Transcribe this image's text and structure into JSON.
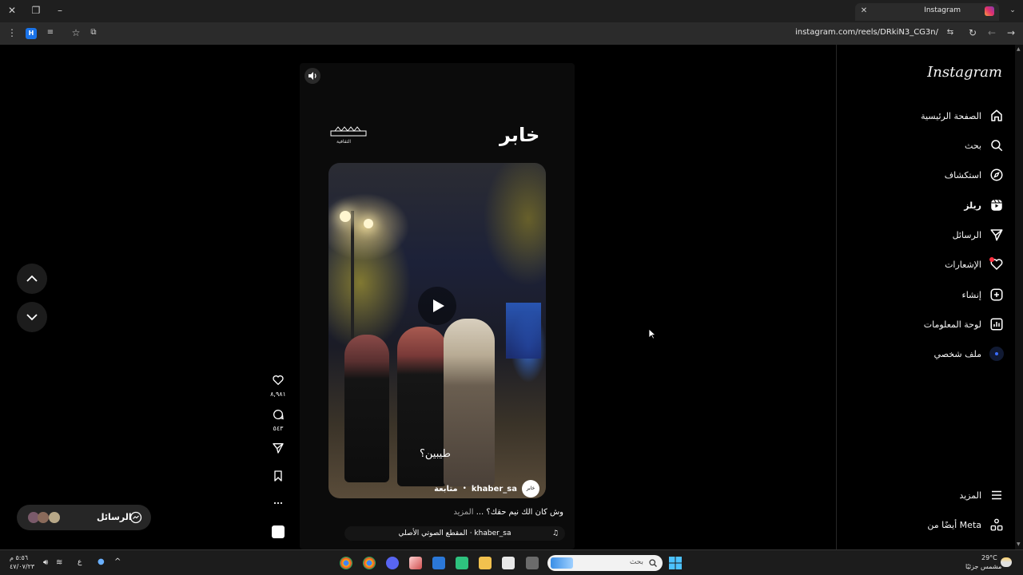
{
  "browser": {
    "tab_title": "Instagram",
    "url": "instagram.com/reels/DRkiN3_CG3n/",
    "profile_letter": "H"
  },
  "sidebar": {
    "logo": "Instagram",
    "items": [
      {
        "label": "الصفحة الرئيسية",
        "icon": "home-icon"
      },
      {
        "label": "بحث",
        "icon": "search-icon"
      },
      {
        "label": "استكشاف",
        "icon": "compass-icon"
      },
      {
        "label": "ريلز",
        "icon": "reels-icon"
      },
      {
        "label": "الرسائل",
        "icon": "send-icon"
      },
      {
        "label": "الإشعارات",
        "icon": "heart-icon"
      },
      {
        "label": "إنشاء",
        "icon": "plus-square-icon"
      },
      {
        "label": "لوحة المعلومات",
        "icon": "dashboard-icon"
      },
      {
        "label": "ملف شخصي",
        "icon": "profile-avatar"
      }
    ],
    "more_label": "المزيد",
    "meta_label": "أيضًا من Meta"
  },
  "reel": {
    "brand_text": "خابر",
    "brand_small": "الثقافية",
    "video_caption": "طيبين؟",
    "username": "khaber_sa",
    "follow_label": "متابعة",
    "caption": "وش كان الك نيم حقك؟ ...",
    "caption_more": "المزيد",
    "audio": "المقطع الصوتي الأصلي · khaber_sa",
    "likes": "٨,٩٨١",
    "comments": "٥٤٣"
  },
  "messages_pill": {
    "label": "الرسائل"
  },
  "taskbar": {
    "search_placeholder": "بحث",
    "weather_temp": "29°C",
    "weather_desc": "مشمس جزئيًا",
    "time": "٥:٥٦ م",
    "date": "٤٧/٠٧/٢٣",
    "lang": "ع"
  },
  "colors": {
    "background": "#000000",
    "notification_dot": "#ff3040",
    "accent": "#0095f6"
  }
}
